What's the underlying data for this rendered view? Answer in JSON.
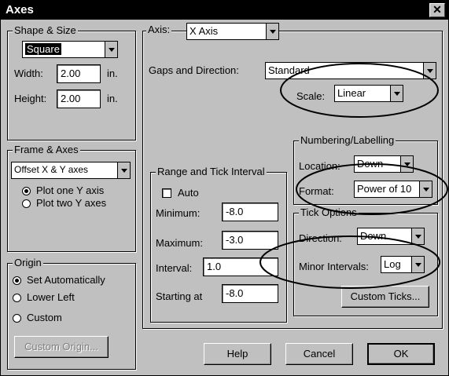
{
  "window": {
    "title": "Axes",
    "close_glyph": "✕"
  },
  "shape_size": {
    "legend": "Shape & Size",
    "shape_value": "Square",
    "width_label": "Width:",
    "width_value": "2.00",
    "width_unit": "in.",
    "height_label": "Height:",
    "height_value": "2.00",
    "height_unit": "in."
  },
  "frame_axes": {
    "legend": "Frame & Axes",
    "select_value": "Offset X & Y axes",
    "plot_one": "Plot one Y axis",
    "plot_two": "Plot two Y axes",
    "plot_selected": "one"
  },
  "origin": {
    "legend": "Origin",
    "set_auto": "Set Automatically",
    "lower_left": "Lower Left",
    "custom": "Custom",
    "custom_origin_button": "Custom Origin...",
    "selected": "set_auto"
  },
  "axis": {
    "label": "Axis:",
    "value": "X Axis"
  },
  "gaps": {
    "label": "Gaps and Direction:",
    "value": "Standard"
  },
  "scale": {
    "label": "Scale:",
    "value": "Linear"
  },
  "numbering": {
    "legend": "Numbering/Labelling",
    "location_label": "Location:",
    "location_value": "Down",
    "format_label": "Format:",
    "format_value": "Power of 10"
  },
  "range": {
    "legend": "Range and Tick Interval",
    "auto_label": "Auto",
    "auto_checked": false,
    "minimum_label": "Minimum:",
    "minimum_value": "-8.0",
    "maximum_label": "Maximum:",
    "maximum_value": "-3.0",
    "interval_label": "Interval:",
    "interval_value": "1.0",
    "starting_label": "Starting at",
    "starting_value": "-8.0"
  },
  "tick_options": {
    "legend": "Tick Options",
    "direction_label": "Direction:",
    "direction_value": "Down",
    "minor_label": "Minor Intervals:",
    "minor_value": "Log",
    "custom_ticks_button": "Custom Ticks..."
  },
  "buttons": {
    "help": "Help",
    "cancel": "Cancel",
    "ok": "OK"
  }
}
